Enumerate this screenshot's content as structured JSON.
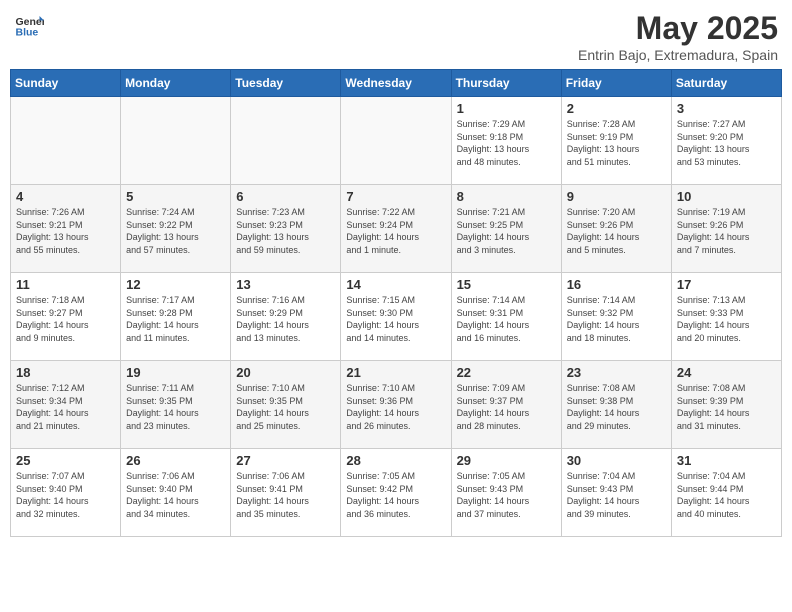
{
  "logo": {
    "general": "General",
    "blue": "Blue"
  },
  "title": "May 2025",
  "subtitle": "Entrin Bajo, Extremadura, Spain",
  "weekdays": [
    "Sunday",
    "Monday",
    "Tuesday",
    "Wednesday",
    "Thursday",
    "Friday",
    "Saturday"
  ],
  "weeks": [
    [
      {
        "day": "",
        "info": ""
      },
      {
        "day": "",
        "info": ""
      },
      {
        "day": "",
        "info": ""
      },
      {
        "day": "",
        "info": ""
      },
      {
        "day": "1",
        "info": "Sunrise: 7:29 AM\nSunset: 9:18 PM\nDaylight: 13 hours\nand 48 minutes."
      },
      {
        "day": "2",
        "info": "Sunrise: 7:28 AM\nSunset: 9:19 PM\nDaylight: 13 hours\nand 51 minutes."
      },
      {
        "day": "3",
        "info": "Sunrise: 7:27 AM\nSunset: 9:20 PM\nDaylight: 13 hours\nand 53 minutes."
      }
    ],
    [
      {
        "day": "4",
        "info": "Sunrise: 7:26 AM\nSunset: 9:21 PM\nDaylight: 13 hours\nand 55 minutes."
      },
      {
        "day": "5",
        "info": "Sunrise: 7:24 AM\nSunset: 9:22 PM\nDaylight: 13 hours\nand 57 minutes."
      },
      {
        "day": "6",
        "info": "Sunrise: 7:23 AM\nSunset: 9:23 PM\nDaylight: 13 hours\nand 59 minutes."
      },
      {
        "day": "7",
        "info": "Sunrise: 7:22 AM\nSunset: 9:24 PM\nDaylight: 14 hours\nand 1 minute."
      },
      {
        "day": "8",
        "info": "Sunrise: 7:21 AM\nSunset: 9:25 PM\nDaylight: 14 hours\nand 3 minutes."
      },
      {
        "day": "9",
        "info": "Sunrise: 7:20 AM\nSunset: 9:26 PM\nDaylight: 14 hours\nand 5 minutes."
      },
      {
        "day": "10",
        "info": "Sunrise: 7:19 AM\nSunset: 9:26 PM\nDaylight: 14 hours\nand 7 minutes."
      }
    ],
    [
      {
        "day": "11",
        "info": "Sunrise: 7:18 AM\nSunset: 9:27 PM\nDaylight: 14 hours\nand 9 minutes."
      },
      {
        "day": "12",
        "info": "Sunrise: 7:17 AM\nSunset: 9:28 PM\nDaylight: 14 hours\nand 11 minutes."
      },
      {
        "day": "13",
        "info": "Sunrise: 7:16 AM\nSunset: 9:29 PM\nDaylight: 14 hours\nand 13 minutes."
      },
      {
        "day": "14",
        "info": "Sunrise: 7:15 AM\nSunset: 9:30 PM\nDaylight: 14 hours\nand 14 minutes."
      },
      {
        "day": "15",
        "info": "Sunrise: 7:14 AM\nSunset: 9:31 PM\nDaylight: 14 hours\nand 16 minutes."
      },
      {
        "day": "16",
        "info": "Sunrise: 7:14 AM\nSunset: 9:32 PM\nDaylight: 14 hours\nand 18 minutes."
      },
      {
        "day": "17",
        "info": "Sunrise: 7:13 AM\nSunset: 9:33 PM\nDaylight: 14 hours\nand 20 minutes."
      }
    ],
    [
      {
        "day": "18",
        "info": "Sunrise: 7:12 AM\nSunset: 9:34 PM\nDaylight: 14 hours\nand 21 minutes."
      },
      {
        "day": "19",
        "info": "Sunrise: 7:11 AM\nSunset: 9:35 PM\nDaylight: 14 hours\nand 23 minutes."
      },
      {
        "day": "20",
        "info": "Sunrise: 7:10 AM\nSunset: 9:35 PM\nDaylight: 14 hours\nand 25 minutes."
      },
      {
        "day": "21",
        "info": "Sunrise: 7:10 AM\nSunset: 9:36 PM\nDaylight: 14 hours\nand 26 minutes."
      },
      {
        "day": "22",
        "info": "Sunrise: 7:09 AM\nSunset: 9:37 PM\nDaylight: 14 hours\nand 28 minutes."
      },
      {
        "day": "23",
        "info": "Sunrise: 7:08 AM\nSunset: 9:38 PM\nDaylight: 14 hours\nand 29 minutes."
      },
      {
        "day": "24",
        "info": "Sunrise: 7:08 AM\nSunset: 9:39 PM\nDaylight: 14 hours\nand 31 minutes."
      }
    ],
    [
      {
        "day": "25",
        "info": "Sunrise: 7:07 AM\nSunset: 9:40 PM\nDaylight: 14 hours\nand 32 minutes."
      },
      {
        "day": "26",
        "info": "Sunrise: 7:06 AM\nSunset: 9:40 PM\nDaylight: 14 hours\nand 34 minutes."
      },
      {
        "day": "27",
        "info": "Sunrise: 7:06 AM\nSunset: 9:41 PM\nDaylight: 14 hours\nand 35 minutes."
      },
      {
        "day": "28",
        "info": "Sunrise: 7:05 AM\nSunset: 9:42 PM\nDaylight: 14 hours\nand 36 minutes."
      },
      {
        "day": "29",
        "info": "Sunrise: 7:05 AM\nSunset: 9:43 PM\nDaylight: 14 hours\nand 37 minutes."
      },
      {
        "day": "30",
        "info": "Sunrise: 7:04 AM\nSunset: 9:43 PM\nDaylight: 14 hours\nand 39 minutes."
      },
      {
        "day": "31",
        "info": "Sunrise: 7:04 AM\nSunset: 9:44 PM\nDaylight: 14 hours\nand 40 minutes."
      }
    ]
  ]
}
